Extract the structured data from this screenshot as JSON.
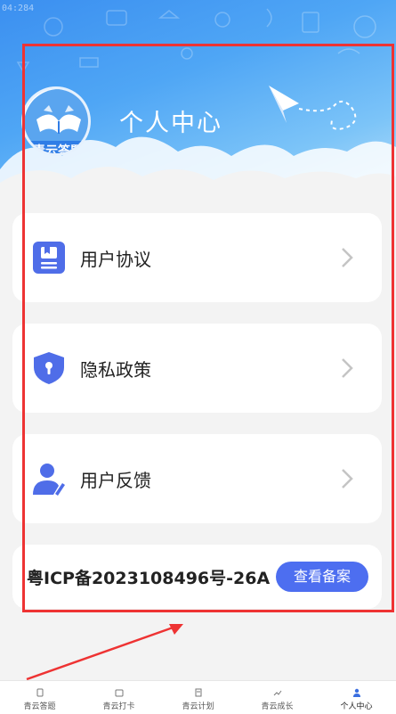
{
  "status": {
    "corner_text": "04:284"
  },
  "header": {
    "title": "个人中心",
    "logo_text": "青云答题"
  },
  "menu": [
    {
      "label": "用户协议",
      "icon": "document-icon"
    },
    {
      "label": "隐私政策",
      "icon": "shield-lock-icon"
    },
    {
      "label": "用户反馈",
      "icon": "user-edit-icon"
    }
  ],
  "icp": {
    "text": "粤ICP备2023108496号-26A",
    "button": "查看备案"
  },
  "tabbar": {
    "tabs": [
      {
        "label": "青云答题"
      },
      {
        "label": "青云打卡"
      },
      {
        "label": "青云计划"
      },
      {
        "label": "青云成长"
      },
      {
        "label": "个人中心"
      }
    ],
    "active_index": 4
  },
  "colors": {
    "accent": "#4d6ef0",
    "header_blue": "#3b8ff0",
    "annotation_red": "#ee3333",
    "card_icon": "#4f6de8"
  }
}
